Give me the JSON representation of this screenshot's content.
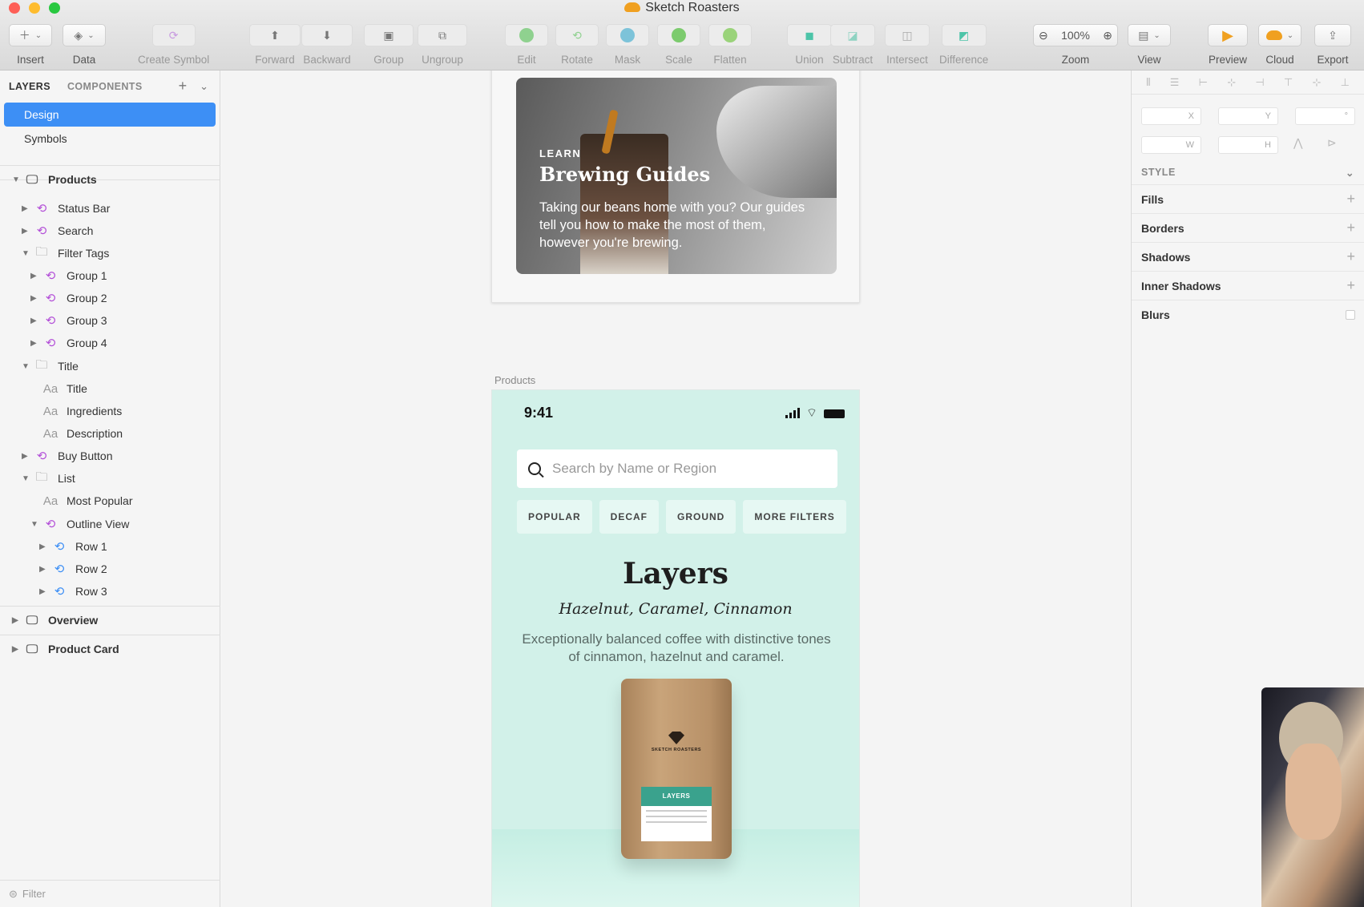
{
  "window": {
    "title": "Sketch Roasters"
  },
  "toolbar": {
    "insert": "Insert",
    "data": "Data",
    "create_symbol": "Create Symbol",
    "forward": "Forward",
    "backward": "Backward",
    "group": "Group",
    "ungroup": "Ungroup",
    "edit": "Edit",
    "rotate": "Rotate",
    "mask": "Mask",
    "scale": "Scale",
    "flatten": "Flatten",
    "union": "Union",
    "subtract": "Subtract",
    "intersect": "Intersect",
    "difference": "Difference",
    "zoom": "Zoom",
    "zoom_value": "100%",
    "view": "View",
    "preview": "Preview",
    "cloud": "Cloud",
    "export": "Export"
  },
  "sidebar": {
    "tab_layers": "LAYERS",
    "tab_components": "COMPONENTS",
    "pages": [
      "Design",
      "Symbols"
    ],
    "layers": [
      {
        "label": "Products",
        "kind": "artboard",
        "icon": "artboard-icon"
      },
      {
        "label": "Status Bar",
        "kind": "symbol",
        "icon": "symbol-icon"
      },
      {
        "label": "Search",
        "kind": "symbol",
        "icon": "symbol-icon"
      },
      {
        "label": "Filter Tags",
        "kind": "folder",
        "icon": "folder-icon"
      },
      {
        "label": "Group 1",
        "kind": "symbol",
        "icon": "symbol-icon"
      },
      {
        "label": "Group 2",
        "kind": "symbol",
        "icon": "symbol-icon"
      },
      {
        "label": "Group 3",
        "kind": "symbol",
        "icon": "symbol-icon"
      },
      {
        "label": "Group 4",
        "kind": "symbol",
        "icon": "symbol-icon"
      },
      {
        "label": "Title",
        "kind": "folder",
        "icon": "folder-icon"
      },
      {
        "label": "Title",
        "kind": "text",
        "icon": "text-icon"
      },
      {
        "label": "Ingredients",
        "kind": "text",
        "icon": "text-icon"
      },
      {
        "label": "Description",
        "kind": "text",
        "icon": "text-icon"
      },
      {
        "label": "Buy Button",
        "kind": "symbol",
        "icon": "symbol-icon"
      },
      {
        "label": "List",
        "kind": "folder",
        "icon": "folder-icon"
      },
      {
        "label": "Most Popular",
        "kind": "text",
        "icon": "text-icon"
      },
      {
        "label": "Outline View",
        "kind": "symbol",
        "icon": "symbol-icon"
      },
      {
        "label": "Row 1",
        "kind": "symbol-blue",
        "icon": "symbol-icon"
      },
      {
        "label": "Row 2",
        "kind": "symbol-blue",
        "icon": "symbol-icon"
      },
      {
        "label": "Row 3",
        "kind": "symbol-blue",
        "icon": "symbol-icon"
      },
      {
        "label": "Overview",
        "kind": "artboard",
        "icon": "artboard-icon"
      },
      {
        "label": "Product Card",
        "kind": "artboard",
        "icon": "artboard-icon"
      }
    ],
    "filter_placeholder": "Filter"
  },
  "canvas": {
    "card": {
      "kicker": "LEARN",
      "title": "Brewing Guides",
      "description": "Taking our beans home with you? Our guides tell you how to make the most of them, however you're brewing."
    },
    "artboard_label": "Products",
    "phone": {
      "time": "9:41",
      "search_placeholder": "Search by Name or Region",
      "tags": [
        "POPULAR",
        "DECAF",
        "GROUND",
        "MORE FILTERS"
      ],
      "title": "Layers",
      "ingredients": "Hazelnut, Caramel, Cinnamon",
      "description": "Exceptionally balanced coffee with distinctive tones of cinnamon, hazelnut and caramel.",
      "bag_brand": "SKETCH ROASTERS",
      "bag_label": "LAYERS"
    }
  },
  "inspector": {
    "fields": {
      "x": "X",
      "y": "Y",
      "rot": "°",
      "w": "W",
      "h": "H"
    },
    "style_header": "STYLE",
    "props": [
      "Fills",
      "Borders",
      "Shadows",
      "Inner Shadows",
      "Blurs"
    ]
  },
  "colors": {
    "accent": "#3d8ff5",
    "symbol": "#b34fd8",
    "phone_bg": "#d2f1e9",
    "bag_band": "#3aa28d"
  }
}
